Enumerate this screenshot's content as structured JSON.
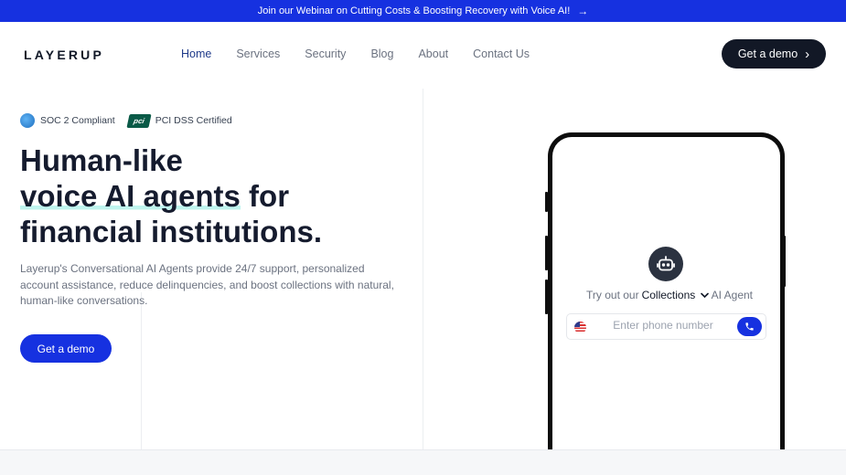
{
  "banner": {
    "text": "Join our Webinar on Cutting Costs & Boosting Recovery with Voice AI!",
    "arrow": "→"
  },
  "header": {
    "logo": "LAYERUP",
    "nav": [
      "Home",
      "Services",
      "Security",
      "Blog",
      "About",
      "Contact Us"
    ],
    "active": "Home",
    "cta": "Get a demo",
    "cta_chevron": "›"
  },
  "hero": {
    "badges": [
      {
        "label": "SOC 2 Compliant",
        "icon": "soc2-icon"
      },
      {
        "label": "PCI DSS Certified",
        "icon": "pci-icon",
        "icon_text": "pci"
      }
    ],
    "title_line1": "Human-like",
    "title_highlight": "voice AI agents",
    "title_line2_rest": " for",
    "title_line3": "financial institutions.",
    "description": "Layerup's Conversational AI Agents provide 24/7 support, personalized account assistance, reduce delinquencies, and boost collections with natural, human-like conversations.",
    "cta": "Get a demo"
  },
  "phone": {
    "try_prefix": "Try out our",
    "selected_agent": "Collections",
    "try_suffix": "AI Agent",
    "input_placeholder": "Enter phone number"
  },
  "colors": {
    "accent": "#1631e0",
    "dark": "#121826",
    "highlight": "#bff4ee"
  }
}
